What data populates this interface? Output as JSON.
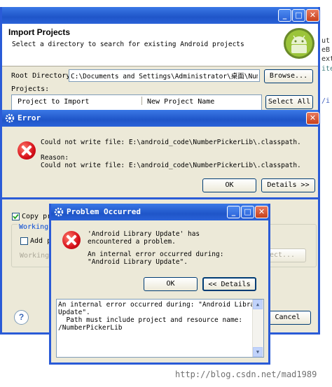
{
  "background_editor": {
    "fragments": [
      "ut",
      "eB",
      "ext",
      "ite",
      "/i"
    ]
  },
  "import_window": {
    "title": "",
    "heading": "Import Projects",
    "subtitle": "Select a directory to search for existing Android projects",
    "root_dir_label": "Root Directory:",
    "root_dir_value": "C:\\Documents and Settings\\Administrator\\桌面\\NumberPi",
    "browse_label": "Browse...",
    "projects_label": "Projects:",
    "columns": [
      "Project to Import",
      "New Project Name"
    ],
    "select_all_label": "Select All",
    "copy_label": "Copy pro",
    "working_sets_label": "Working s",
    "add_label": "Add pr",
    "working_sets_combo_label": "Working s",
    "select_label": "ect...",
    "cancel_label": "Cancel",
    "help_icon_char": "?"
  },
  "error_dialog": {
    "title": "Error",
    "message1": "Could not write file: E:\\android_code\\NumberPickerLib\\.classpath.",
    "reason_label": "Reason:",
    "message2": "Could not write file: E:\\android_code\\NumberPickerLib\\.classpath.",
    "ok_label": "OK",
    "details_label": "Details >>"
  },
  "problem_dialog": {
    "title": "Problem Occurred",
    "message1": "'Android Library Update' has encountered a problem.",
    "message2": "An internal error occurred during: \"Android Library Update\".",
    "ok_label": "OK",
    "details_label": "<< Details",
    "details_lines": [
      "An internal error occurred during: \"Android Library",
      "Update\".",
      "  Path must include project and resource name:",
      "/NumberPickerLib"
    ]
  },
  "watermark": "http://blog.csdn.net/mad1989",
  "colors": {
    "titlebar": "#1f55c8",
    "dialog_bg": "#ece9d8",
    "error_red": "#d6101a"
  }
}
